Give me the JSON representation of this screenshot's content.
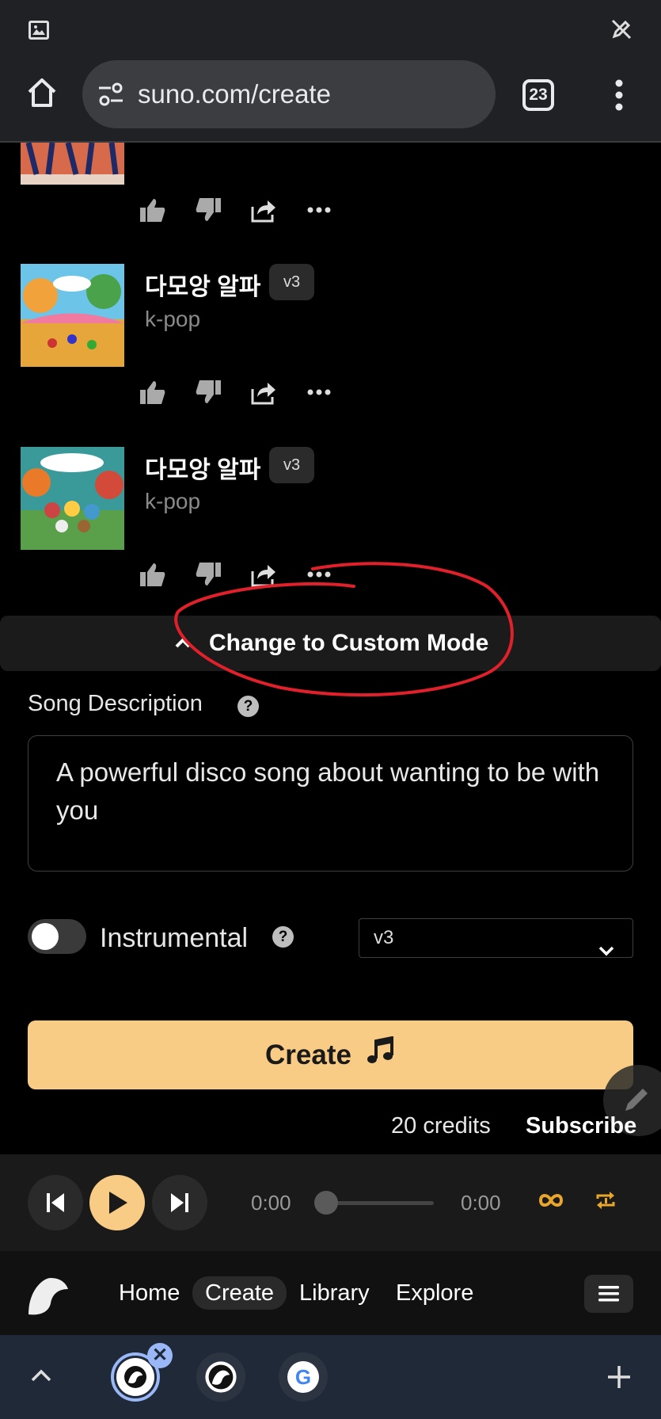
{
  "browser": {
    "url": "suno.com/create",
    "tab_count": "23"
  },
  "songs": [
    {
      "title": "다모앙 알파",
      "version": "v3",
      "genre": "k-pop"
    },
    {
      "title": "다모앙 알파",
      "version": "v3",
      "genre": "k-pop"
    }
  ],
  "mode_toggle": {
    "label": "Change to Custom Mode"
  },
  "form": {
    "description_label": "Song Description",
    "description_value": "A powerful disco song about wanting to be with you",
    "instrumental_label": "Instrumental",
    "model_select_value": "v3",
    "create_label": "Create",
    "credits": "20 credits",
    "subscribe": "Subscribe"
  },
  "player": {
    "current_time": "0:00",
    "total_time": "0:00",
    "progress": 0
  },
  "nav": {
    "items": [
      "Home",
      "Create",
      "Library",
      "Explore"
    ],
    "active": "Create"
  },
  "colors": {
    "accent": "#f9cc85",
    "annotation": "#e0202a",
    "loop": "#e8a62a"
  },
  "icons": {
    "status_left": "image-icon",
    "status_right": "pen-off-icon",
    "player_loop": "infinity-icon",
    "player_repeat": "repeat-icon"
  }
}
